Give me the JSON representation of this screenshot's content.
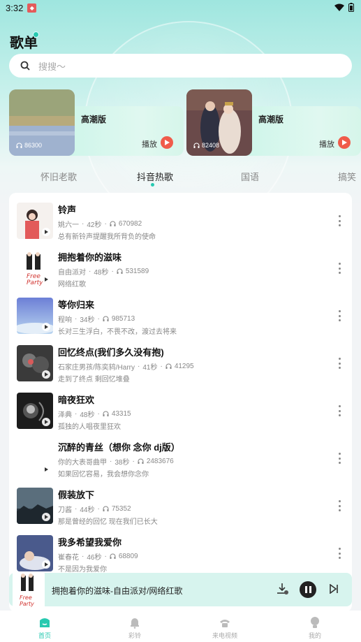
{
  "status_bar": {
    "time": "3:32"
  },
  "header": {
    "title": "歌单"
  },
  "search": {
    "placeholder": "搜搜～"
  },
  "banners": [
    {
      "name": "高潮版",
      "play_label": "播放",
      "count": "86300"
    },
    {
      "name": "高潮版",
      "play_label": "播放",
      "count": "82408"
    }
  ],
  "tabs": [
    {
      "label": "怀旧老歌"
    },
    {
      "label": "抖音热歌",
      "active": true
    },
    {
      "label": "国语"
    },
    {
      "label": "搞笑"
    }
  ],
  "songs": [
    {
      "title": "铃声",
      "artist": "姚六一",
      "duration": "42秒",
      "plays": "670982",
      "desc": "总有新铃声提醒我所背负的使命"
    },
    {
      "title": "拥抱着你的滋味",
      "artist": "自由派对",
      "duration": "48秒",
      "plays": "531589",
      "desc": "网络红歌"
    },
    {
      "title": "等你归来",
      "artist": "程响",
      "duration": "34秒",
      "plays": "985713",
      "desc": "长对三生浮白，不畏不改，渡过去将来"
    },
    {
      "title": "回忆终点(我们多久没有抱)",
      "artist": "石家庄男孩/陈奕鸫/Harry",
      "duration": "41秒",
      "plays": "41295",
      "desc": "走到了终点 剩回忆堆叠"
    },
    {
      "title": "暗夜狂欢",
      "artist": "泽典",
      "duration": "48秒",
      "plays": "43315",
      "desc": "孤独的人唱夜里狂欢"
    },
    {
      "title": "沉醉的青丝（想你 念你 dj版）",
      "artist": "你的大表哥曲甲",
      "duration": "38秒",
      "plays": "2483676",
      "desc": "如果回忆容易，我会想你念你"
    },
    {
      "title": "假装放下",
      "artist": "刀酱",
      "duration": "44秒",
      "plays": "75352",
      "desc": "那是曾经的回忆 现在我们已长大"
    },
    {
      "title": "我多希望我爱你",
      "artist": "崔春花",
      "duration": "46秒",
      "plays": "68809",
      "desc": "不是因为我爱你"
    }
  ],
  "player": {
    "now_playing": "拥抱着你的滋味-自由派对/网络红歌"
  },
  "bottom_nav": [
    {
      "label": "首页",
      "active": true
    },
    {
      "label": "彩铃"
    },
    {
      "label": "来电视频"
    },
    {
      "label": "我的"
    }
  ],
  "colors": {
    "accent": "#27c9b0",
    "play_red": "#f05b4a"
  }
}
